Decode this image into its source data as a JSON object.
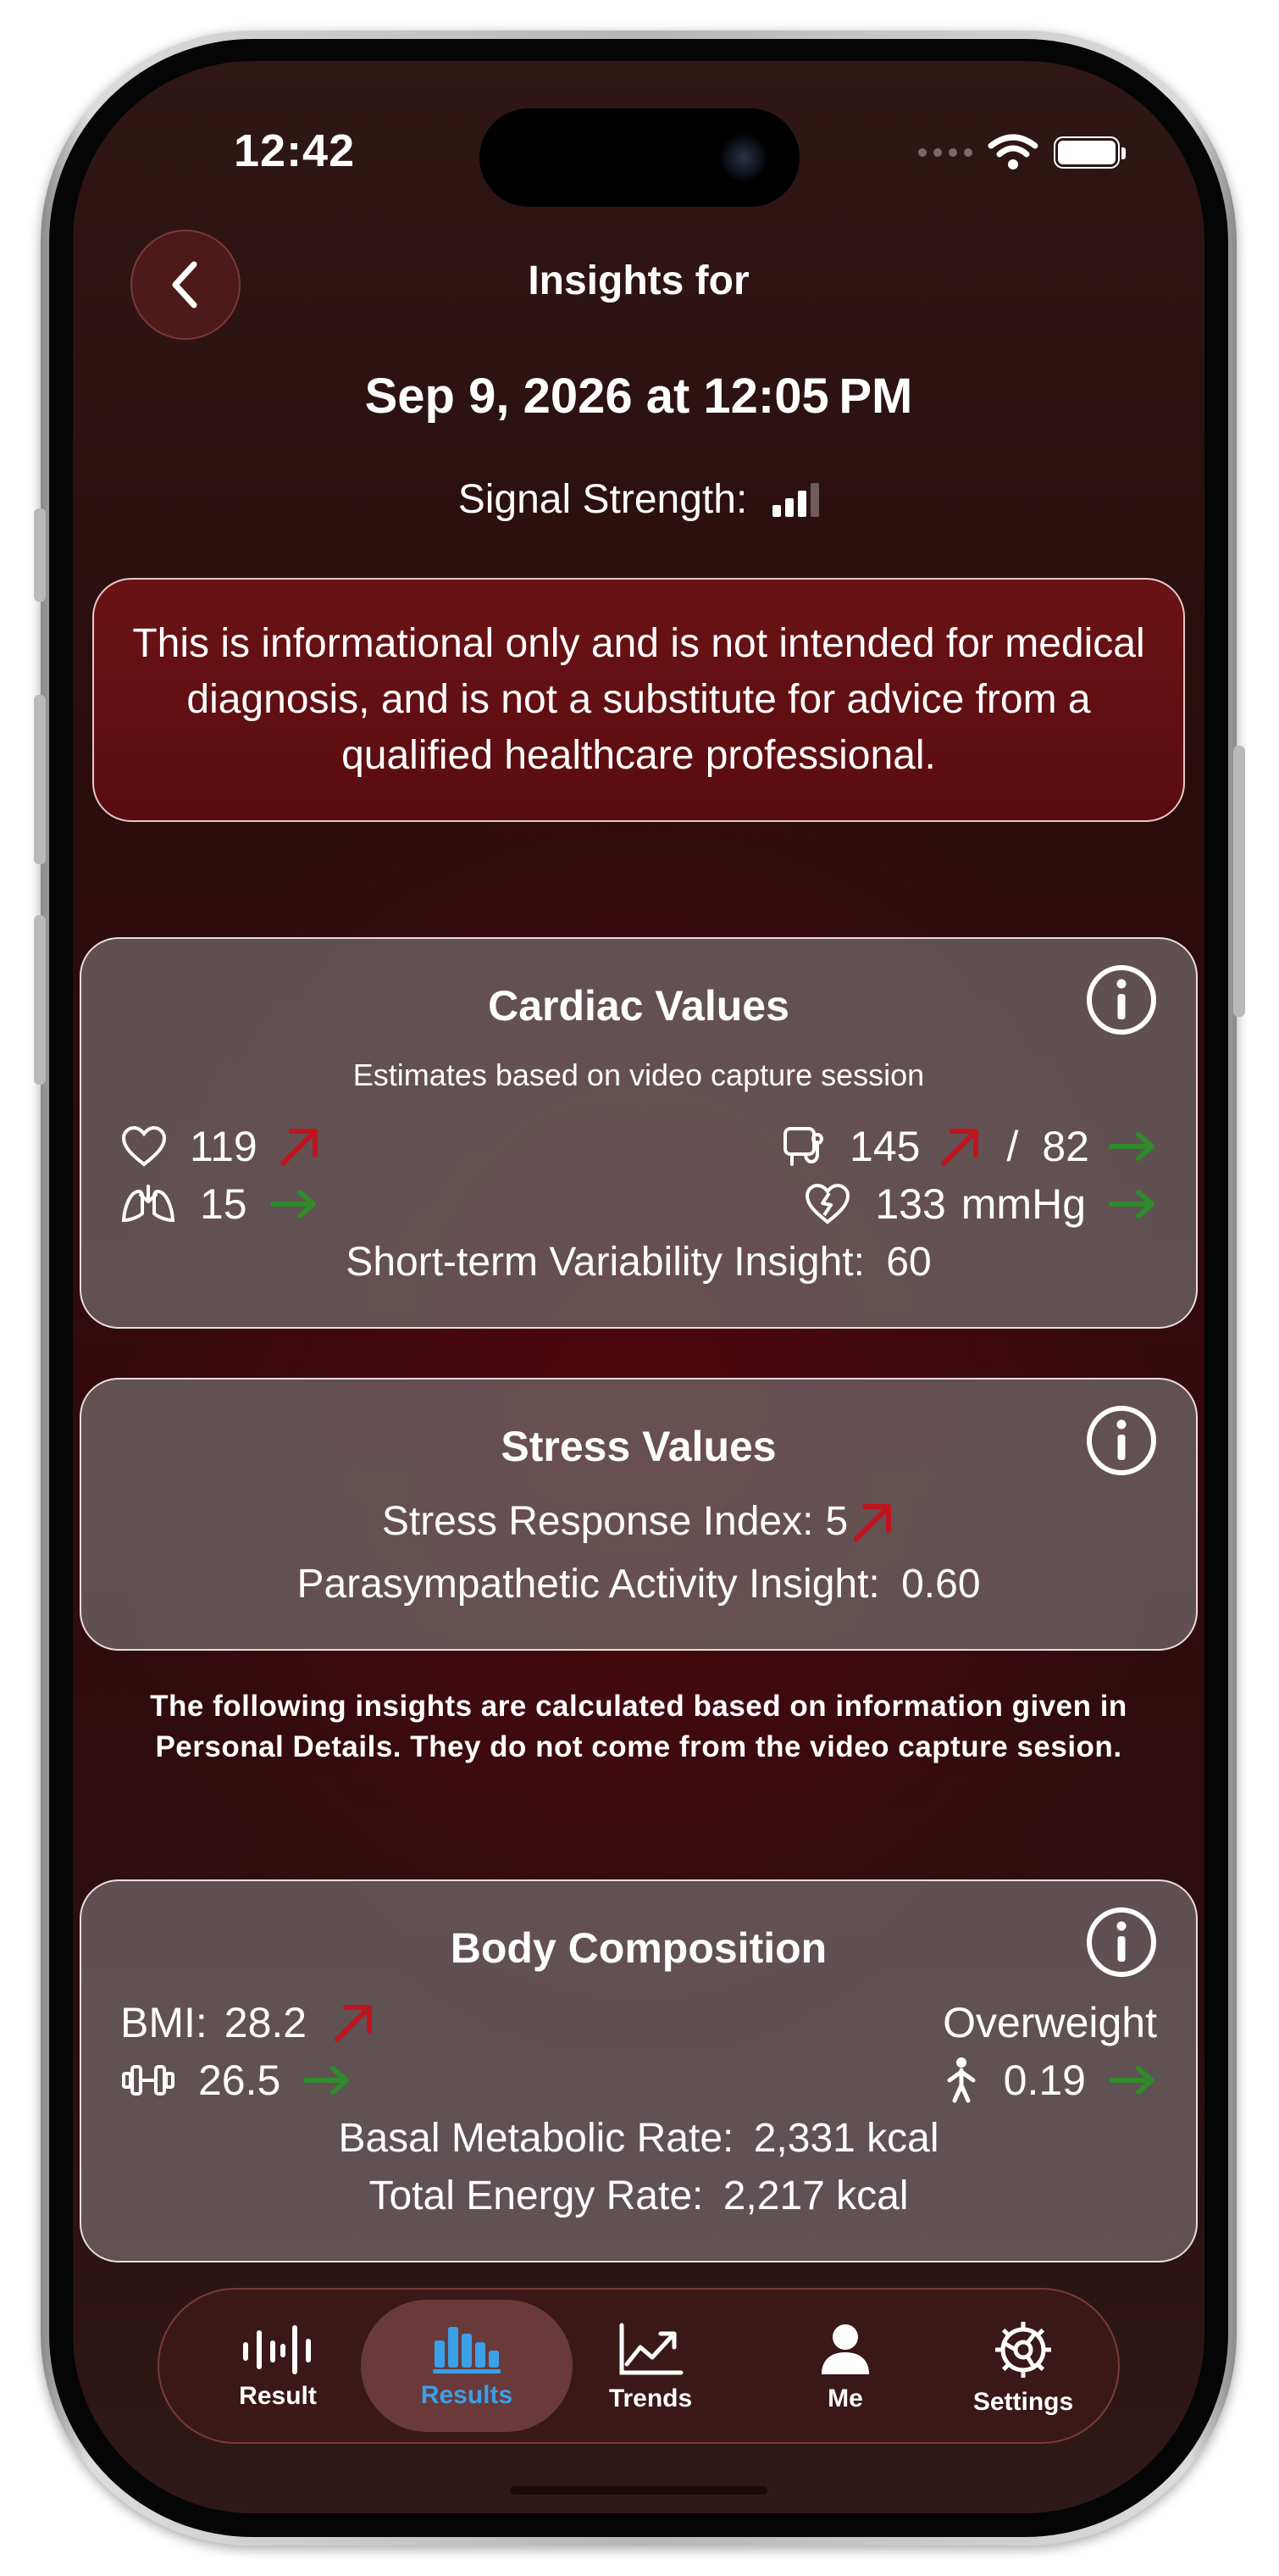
{
  "status_bar": {
    "time": "12:42"
  },
  "header": {
    "title": "Insights for",
    "date": "Sep 9, 2026 at 12:05 PM",
    "signal_label": "Signal Strength:",
    "signal_level": 0.75
  },
  "disclaimer": "This is informational only and is not intended for medical diagnosis, and is not a substitute for advice from a qualified healthcare professional.",
  "cardiac": {
    "title": "Cardiac Values",
    "subtitle": "Estimates based on video capture session",
    "heart_rate": "119",
    "breathing_rate": "15",
    "systolic": "145",
    "separator": "/",
    "diastolic": "82",
    "pulse_pressure": "133",
    "pulse_pressure_unit": "mmHg",
    "variability_label": "Short-term Variability Insight:",
    "variability_value": "60"
  },
  "stress": {
    "title": "Stress Values",
    "index_label": "Stress Response Index:",
    "index_value": "5",
    "parasympathetic_label": "Parasympathetic Activity Insight:",
    "parasympathetic_value": "0.60"
  },
  "note": "The following insights are calculated based on information given in Personal Details. They do not come from the video capture sesion.",
  "body": {
    "title": "Body Composition",
    "bmi_label": "BMI:",
    "bmi_value": "28.2",
    "bmi_category": "Overweight",
    "body_fat": "26.5",
    "waist_ratio": "0.19",
    "bmr_label": "Basal Metabolic Rate:",
    "bmr_value": "2,331 kcal",
    "ter_label": "Total Energy Rate:",
    "ter_value": "2,217 kcal"
  },
  "tabs": [
    {
      "label": "Result",
      "icon": "waveform-icon"
    },
    {
      "label": "Results",
      "icon": "bar-chart-icon",
      "active": true
    },
    {
      "label": "Trends",
      "icon": "trend-chart-icon"
    },
    {
      "label": "Me",
      "icon": "person-icon"
    },
    {
      "label": "Settings",
      "icon": "gear-icon"
    }
  ],
  "colors": {
    "trend_up": "#c0141e",
    "trend_steady": "#2f8a2b",
    "active_tab": "#3aa0e8"
  }
}
